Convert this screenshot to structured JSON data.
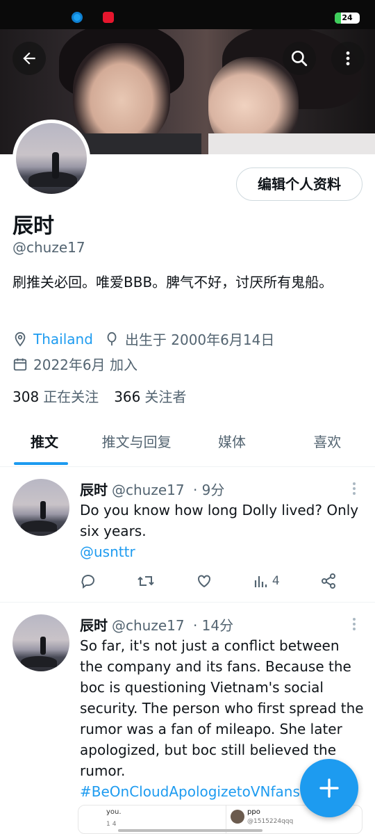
{
  "status_bar": {
    "battery": "24"
  },
  "profile": {
    "edit_button": "编辑个人资料",
    "display_name": "辰时",
    "handle": "@chuze17",
    "bio": "刷推关必回。唯爱BBB。脾气不好，讨厌所有鬼船。",
    "location": "Thailand",
    "birthday": "出生于 2000年6月14日",
    "joined": "2022年6月 加入",
    "following_count": "308",
    "following_label": "正在关注",
    "followers_count": "366",
    "followers_label": "关注者"
  },
  "tabs": [
    {
      "label": "推文"
    },
    {
      "label": "推文与回复"
    },
    {
      "label": "媒体"
    },
    {
      "label": "喜欢"
    }
  ],
  "tweets": [
    {
      "name": "辰时",
      "handle": "@chuze17",
      "time": "· 9分",
      "text": "Do you know how long Dolly lived? Only six years.",
      "link": "@usnttr",
      "views": "4"
    },
    {
      "name": "辰时",
      "handle": "@chuze17",
      "time": "· 14分",
      "text": "So far, it's not just a conflict between the company and its fans. Because the boc is questioning Vietnam's social security. The person who first spread the rumor was a fan of mileapo. She later apologized, but boc still believed the rumor.",
      "link": "#BeOnCloudApologizetoVNfans",
      "quote": {
        "left_text": "you.",
        "left_counts": "14",
        "right_name": "ppo",
        "right_handle": "@1515224qqq"
      }
    }
  ],
  "colors": {
    "accent": "#1d9bf0",
    "text": "#0f1419",
    "muted": "#536471"
  }
}
